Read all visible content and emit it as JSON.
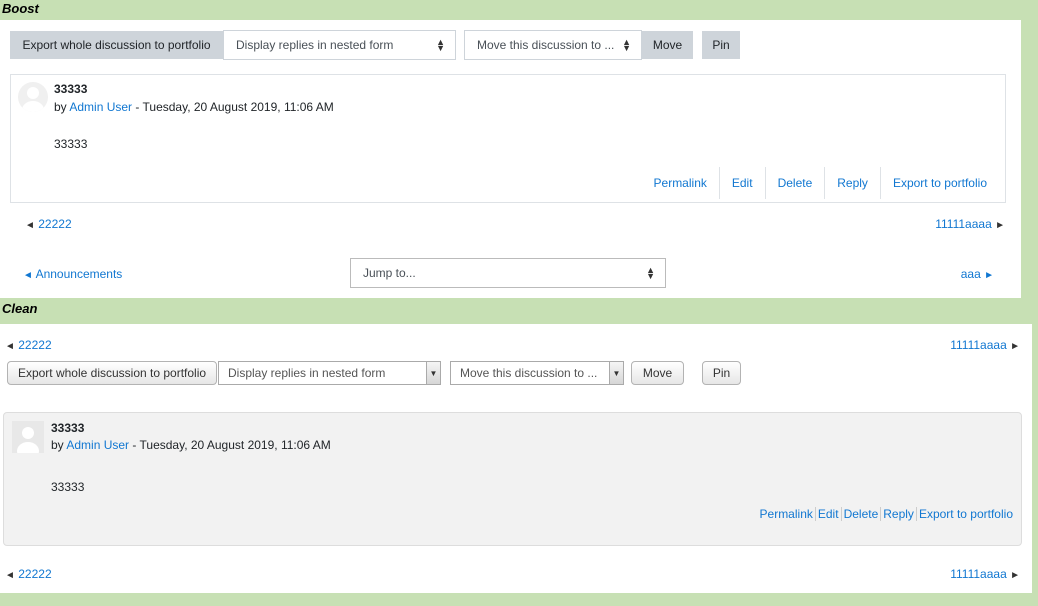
{
  "boost": {
    "label": "Boost",
    "toolbar": {
      "export_label": "Export whole discussion to portfolio",
      "display_select": "Display replies in nested form",
      "move_select": "Move this discussion to ...",
      "move_label": "Move",
      "pin_label": "Pin"
    },
    "post": {
      "subject": "33333",
      "by_prefix": "by",
      "author": "Admin User",
      "date": "- Tuesday, 20 August 2019, 11:06 AM",
      "content": "33333",
      "commands": [
        "Permalink",
        "Edit",
        "Delete",
        "Reply",
        "Export to portfolio"
      ]
    },
    "prev_discussion": "22222",
    "next_discussion": "11111aaaa",
    "prev_activity": "Announcements",
    "jump_select": "Jump to...",
    "next_activity": "aaa"
  },
  "clean": {
    "label": "Clean",
    "prev_discussion_top": "22222",
    "next_discussion_top": "11111aaaa",
    "toolbar": {
      "export_label": "Export whole discussion to portfolio",
      "display_select": "Display replies in nested form",
      "move_select": "Move this discussion to ...",
      "move_label": "Move",
      "pin_label": "Pin"
    },
    "post": {
      "subject": "33333",
      "by_prefix": "by",
      "author": "Admin User",
      "date": "- Tuesday, 20 August 2019, 11:06 AM",
      "content": "33333",
      "commands": [
        "Permalink",
        "Edit",
        "Delete",
        "Reply",
        "Export to portfolio"
      ]
    },
    "prev_discussion_bottom": "22222",
    "next_discussion_bottom": "11111aaaa"
  },
  "icons": {
    "left_arrow": "◄",
    "right_arrow": "►",
    "select_caret": "▲▼",
    "dropdown_caret": "▼"
  }
}
